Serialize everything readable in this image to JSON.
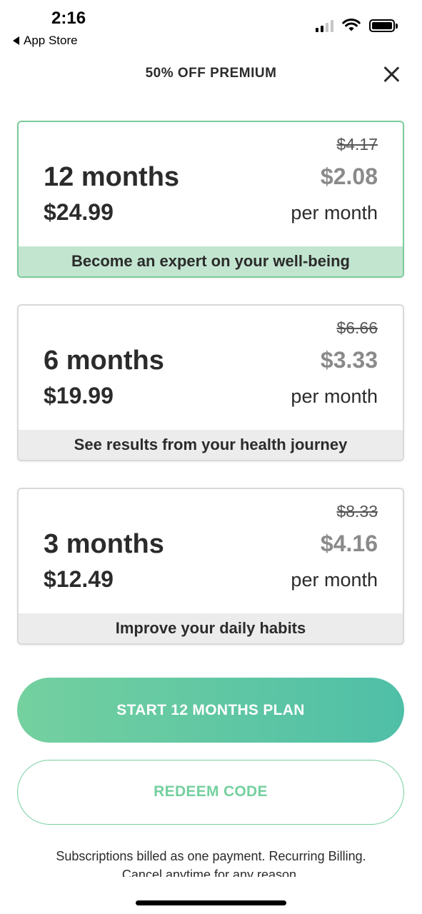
{
  "status_bar": {
    "time": "2:16",
    "back_app": "App Store"
  },
  "header": {
    "title": "50% OFF PREMIUM"
  },
  "plans": [
    {
      "months": "12 months",
      "total": "$24.99",
      "old_monthly": "$4.17",
      "monthly": "$2.08",
      "per": "per month",
      "tagline": "Become an expert on your well-being",
      "selected": true
    },
    {
      "months": "6 months",
      "total": "$19.99",
      "old_monthly": "$6.66",
      "monthly": "$3.33",
      "per": "per month",
      "tagline": "See results from your health journey",
      "selected": false
    },
    {
      "months": "3 months",
      "total": "$12.49",
      "old_monthly": "$8.33",
      "monthly": "$4.16",
      "per": "per month",
      "tagline": "Improve your daily habits",
      "selected": false
    }
  ],
  "buttons": {
    "start": "START 12 MONTHS PLAN",
    "redeem": "REDEEM CODE"
  },
  "footer": {
    "line1": "Subscriptions billed as one payment. Recurring Billing.",
    "line2": "Cancel anytime for any reason."
  },
  "colors": {
    "accent": "#74d09f",
    "accent_end": "#4fbfa7",
    "selected_tag_bg": "#c2e5d0"
  }
}
